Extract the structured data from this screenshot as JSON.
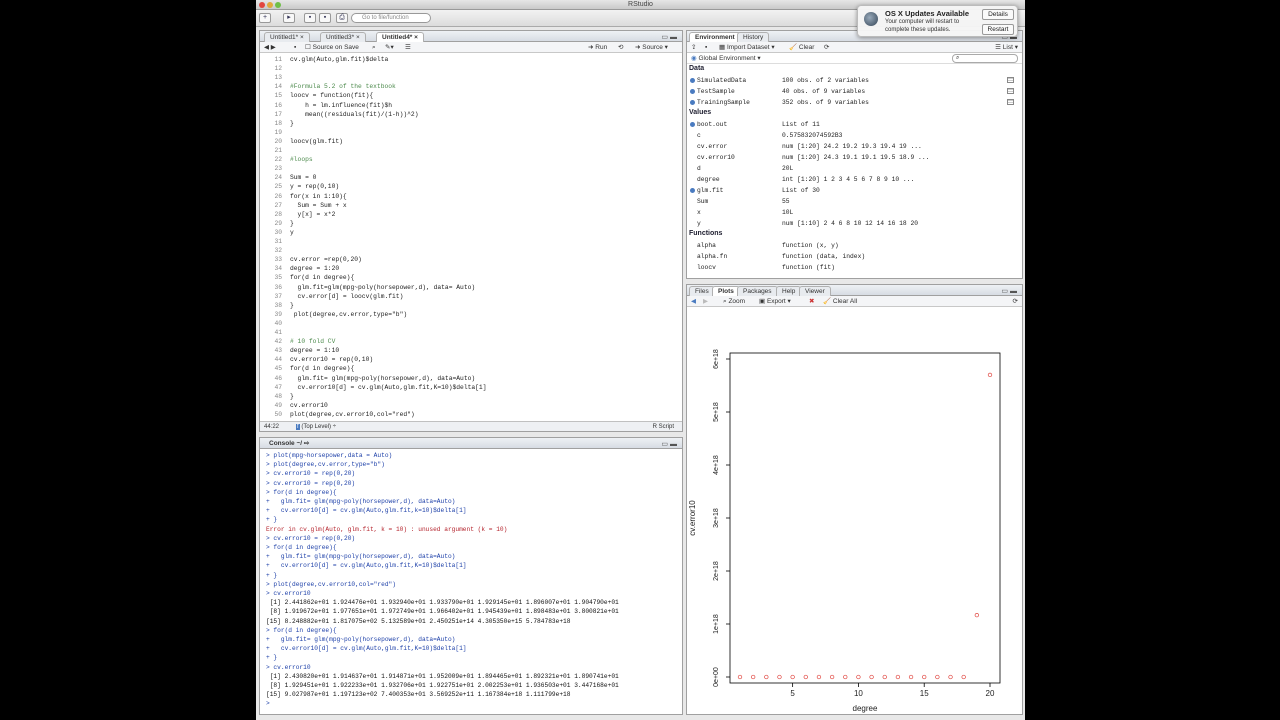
{
  "window": {
    "title": "RStudio"
  },
  "toolbar": {
    "goto_placeholder": "Go to file/function"
  },
  "editor": {
    "tabs": [
      "Untitled1*",
      "Untitled3*",
      "Untitled4*"
    ],
    "source_on_save": "Source on Save",
    "run_label": "Run",
    "source_label": "Source",
    "lines": [
      {
        "n": "11",
        "t": "cv.glm(Auto,glm.fit)$delta",
        "c": false
      },
      {
        "n": "12",
        "t": "",
        "c": false
      },
      {
        "n": "13",
        "t": "",
        "c": false
      },
      {
        "n": "14",
        "t": "#Formula 5.2 of the textbook",
        "c": true
      },
      {
        "n": "15",
        "t": "loocv = function(fit){",
        "c": false
      },
      {
        "n": "16",
        "t": "    h = lm.influence(fit)$h",
        "c": false
      },
      {
        "n": "17",
        "t": "    mean((residuals(fit)/(1-h))^2)",
        "c": false
      },
      {
        "n": "18",
        "t": "}",
        "c": false
      },
      {
        "n": "19",
        "t": "",
        "c": false
      },
      {
        "n": "20",
        "t": "loocv(glm.fit)",
        "c": false
      },
      {
        "n": "21",
        "t": "",
        "c": false
      },
      {
        "n": "22",
        "t": "#loops",
        "c": true
      },
      {
        "n": "23",
        "t": "",
        "c": false
      },
      {
        "n": "24",
        "t": "Sum = 0",
        "c": false
      },
      {
        "n": "25",
        "t": "y = rep(0,10)",
        "c": false
      },
      {
        "n": "26",
        "t": "for(x in 1:10){",
        "c": false
      },
      {
        "n": "27",
        "t": "  Sum = Sum + x",
        "c": false
      },
      {
        "n": "28",
        "t": "  y[x] = x*2",
        "c": false
      },
      {
        "n": "29",
        "t": "}",
        "c": false
      },
      {
        "n": "30",
        "t": "y",
        "c": false
      },
      {
        "n": "31",
        "t": "",
        "c": false
      },
      {
        "n": "32",
        "t": "",
        "c": false
      },
      {
        "n": "33",
        "t": "cv.error =rep(0,20)",
        "c": false
      },
      {
        "n": "34",
        "t": "degree = 1:20",
        "c": false
      },
      {
        "n": "35",
        "t": "for(d in degree){",
        "c": false
      },
      {
        "n": "36",
        "t": "  glm.fit=glm(mpg~poly(horsepower,d), data= Auto)",
        "c": false
      },
      {
        "n": "37",
        "t": "  cv.error[d] = loocv(glm.fit)",
        "c": false
      },
      {
        "n": "38",
        "t": "}",
        "c": false
      },
      {
        "n": "39",
        "t": " plot(degree,cv.error,type=\"b\")",
        "c": false
      },
      {
        "n": "40",
        "t": "",
        "c": false
      },
      {
        "n": "41",
        "t": "",
        "c": false
      },
      {
        "n": "42",
        "t": "# 10 fold CV",
        "c": true
      },
      {
        "n": "43",
        "t": "degree = 1:10",
        "c": false
      },
      {
        "n": "44",
        "t": "cv.error10 = rep(0,10)",
        "c": false
      },
      {
        "n": "45",
        "t": "for(d in degree){",
        "c": false
      },
      {
        "n": "46",
        "t": "  glm.fit= glm(mpg~poly(horsepower,d), data=Auto)",
        "c": false
      },
      {
        "n": "47",
        "t": "  cv.error10[d] = cv.glm(Auto,glm.fit,K=10)$delta[1]",
        "c": false
      },
      {
        "n": "48",
        "t": "}",
        "c": false
      },
      {
        "n": "49",
        "t": "cv.error10",
        "c": false
      },
      {
        "n": "50",
        "t": "plot(degree,cv.error10,col=\"red\")",
        "c": false
      }
    ],
    "status_pos": "44:22",
    "status_scope": "(Top Level)",
    "status_type": "R Script"
  },
  "console": {
    "title": "Console ~/",
    "lines": [
      {
        "t": "> plot(mpg~horsepower,data = Auto)",
        "k": "in"
      },
      {
        "t": "> plot(degree,cv.error,type=\"b\")",
        "k": "in"
      },
      {
        "t": "> cv.error10 = rep(0,20)",
        "k": "in"
      },
      {
        "t": "> cv.error10 = rep(0,20)",
        "k": "in"
      },
      {
        "t": "> for(d in degree){",
        "k": "in"
      },
      {
        "t": "+   glm.fit= glm(mpg~poly(horsepower,d), data=Auto)",
        "k": "in"
      },
      {
        "t": "+   cv.error10[d] = cv.glm(Auto,glm.fit,k=10)$delta[1]",
        "k": "in"
      },
      {
        "t": "+ }",
        "k": "in"
      },
      {
        "t": "Error in cv.glm(Auto, glm.fit, k = 10) : unused argument (k = 10)",
        "k": "err"
      },
      {
        "t": "> cv.error10 = rep(0,20)",
        "k": "in"
      },
      {
        "t": "> for(d in degree){",
        "k": "in"
      },
      {
        "t": "+   glm.fit= glm(mpg~poly(horsepower,d), data=Auto)",
        "k": "in"
      },
      {
        "t": "+   cv.error10[d] = cv.glm(Auto,glm.fit,K=10)$delta[1]",
        "k": "in"
      },
      {
        "t": "+ }",
        "k": "in"
      },
      {
        "t": "> plot(degree,cv.error10,col=\"red\")",
        "k": "in"
      },
      {
        "t": "> cv.error10",
        "k": "in"
      },
      {
        "t": " [1] 2.441862e+01 1.924476e+01 1.932940e+01 1.933790e+01 1.929145e+01 1.896007e+01 1.904790e+01",
        "k": "out"
      },
      {
        "t": " [8] 1.919672e+01 1.977651e+01 1.972749e+01 1.966402e+01 1.945439e+01 1.898483e+01 3.800821e+01",
        "k": "out"
      },
      {
        "t": "[15] 8.248882e+01 1.817075e+02 5.132589e+01 2.450251e+14 4.305350e+15 5.784783e+18",
        "k": "out"
      },
      {
        "t": "> for(d in degree){",
        "k": "in"
      },
      {
        "t": "+   glm.fit= glm(mpg~poly(horsepower,d), data=Auto)",
        "k": "in"
      },
      {
        "t": "+   cv.error10[d] = cv.glm(Auto,glm.fit,K=10)$delta[1]",
        "k": "in"
      },
      {
        "t": "+ }",
        "k": "in"
      },
      {
        "t": "> cv.error10",
        "k": "in"
      },
      {
        "t": " [1] 2.430820e+01 1.914637e+01 1.914871e+01 1.952009e+01 1.894465e+01 1.892321e+01 1.890741e+01",
        "k": "out"
      },
      {
        "t": " [8] 1.929451e+01 1.922233e+01 1.932706e+01 1.922751e+01 2.002253e+01 1.936503e+01 3.447168e+01",
        "k": "out"
      },
      {
        "t": "[15] 9.027987e+01 1.197123e+02 7.400353e+01 3.569252e+11 1.167384e+18 1.111799e+18",
        "k": "out"
      },
      {
        "t": "> ",
        "k": "in"
      }
    ]
  },
  "environment": {
    "tabs": [
      "Environment",
      "History"
    ],
    "import_label": "Import Dataset",
    "clear_label": "Clear",
    "list_label": "List",
    "scope": "Global Environment",
    "data_head": "Data",
    "values_head": "Values",
    "functions_head": "Functions",
    "data": [
      {
        "name": "SimulatedData",
        "value": "100 obs. of 2 variables"
      },
      {
        "name": "TestSample",
        "value": "40 obs. of 9 variables"
      },
      {
        "name": "TrainingSample",
        "value": "352 obs. of 9 variables"
      }
    ],
    "values": [
      {
        "name": "boot.out",
        "value": "List of 11",
        "bullet": true
      },
      {
        "name": "c",
        "value": "0.575832074592B3",
        "bullet": false
      },
      {
        "name": "cv.error",
        "value": "num [1:20] 24.2 19.2 19.3 19.4 19 ...",
        "bullet": false
      },
      {
        "name": "cv.error10",
        "value": "num [1:20] 24.3 19.1 19.1 19.5 18.9 ...",
        "bullet": false
      },
      {
        "name": "d",
        "value": "20L",
        "bullet": false
      },
      {
        "name": "degree",
        "value": "int [1:20] 1 2 3 4 5 6 7 8 9 10 ...",
        "bullet": false
      },
      {
        "name": "glm.fit",
        "value": "List of 30",
        "bullet": true
      },
      {
        "name": "Sum",
        "value": "55",
        "bullet": false
      },
      {
        "name": "x",
        "value": "10L",
        "bullet": false
      },
      {
        "name": "y",
        "value": "num [1:10] 2 4 6 8 10 12 14 16 18 20",
        "bullet": false
      }
    ],
    "functions": [
      {
        "name": "alpha",
        "value": "function (x, y)"
      },
      {
        "name": "alpha.fn",
        "value": "function (data, index)"
      },
      {
        "name": "loocv",
        "value": "function (fit)"
      }
    ]
  },
  "plots": {
    "tabs": [
      "Files",
      "Plots",
      "Packages",
      "Help",
      "Viewer"
    ],
    "zoom_label": "Zoom",
    "export_label": "Export",
    "clear_all_label": "Clear All"
  },
  "notification": {
    "title": "OS X Updates Available",
    "message": "Your computer will restart to complete these updates.",
    "details": "Details",
    "restart": "Restart"
  },
  "chart_data": {
    "type": "scatter",
    "xlabel": "degree",
    "ylabel": "cv.error10",
    "x": [
      1,
      2,
      3,
      4,
      5,
      6,
      7,
      8,
      9,
      10,
      11,
      12,
      13,
      14,
      15,
      16,
      17,
      18,
      19,
      20
    ],
    "y": [
      24.3,
      19.1,
      19.1,
      19.5,
      18.9,
      18.9,
      18.9,
      19.3,
      19.2,
      19.3,
      19.2,
      20.0,
      19.4,
      34.5,
      90.3,
      119.7,
      74.0,
      357000000000.0,
      1.167e+18,
      5.7e+18
    ],
    "xlim": [
      1,
      20
    ],
    "ylim": [
      0,
      6e+18
    ],
    "xticks": [
      "5",
      "10",
      "15",
      "20"
    ],
    "yticks": [
      "0e+00",
      "1e+18",
      "2e+18",
      "3e+18",
      "4e+18",
      "5e+18",
      "6e+18"
    ],
    "point_color": "#e0443e"
  }
}
